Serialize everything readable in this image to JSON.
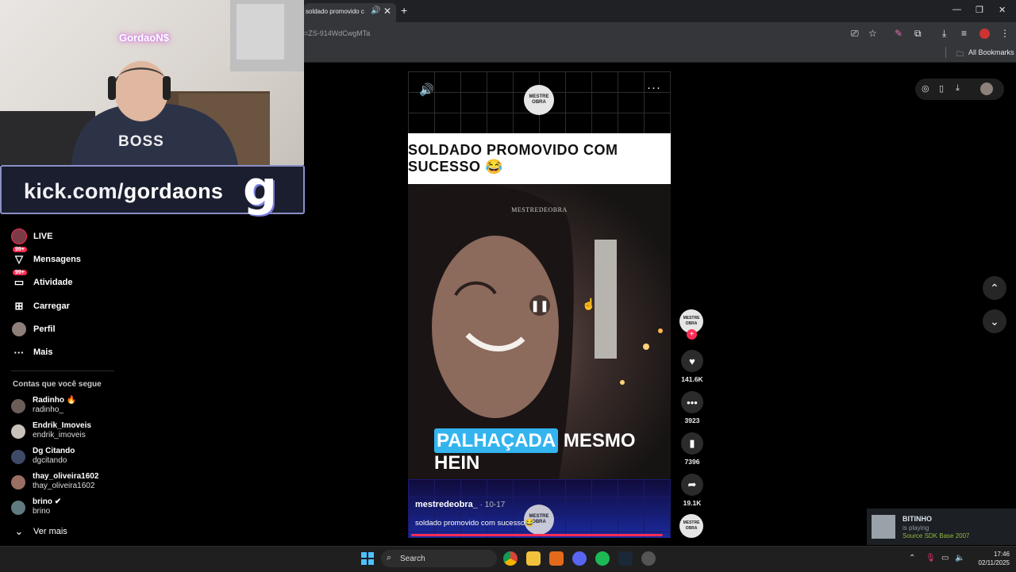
{
  "browser": {
    "tab_title": "soldado promovido c",
    "url": "=ZS-914WdCwgMTa",
    "all_bookmarks": "All Bookmarks"
  },
  "stream": {
    "cam_neon_text": "GordaoN$",
    "shirt_text": "BOSS",
    "kick_url_prefix": "kick.com/",
    "kick_url_name": "gordaons",
    "kick_logo": "g"
  },
  "sidebar": {
    "items": [
      {
        "label": "LIVE",
        "icon": "live-avatar-icon"
      },
      {
        "label": "Mensagens",
        "icon": "message-icon",
        "badge": "99+"
      },
      {
        "label": "Atividade",
        "icon": "activity-icon",
        "badge": "99+"
      },
      {
        "label": "Carregar",
        "icon": "upload-icon"
      },
      {
        "label": "Perfil",
        "icon": "profile-avatar-icon"
      },
      {
        "label": "Mais",
        "icon": "more-icon"
      }
    ],
    "following_title": "Contas que você segue",
    "accounts": [
      {
        "name": "Radinho 🔥",
        "handle": "radinho_"
      },
      {
        "name": "Endrik_Imoveis",
        "handle": "endrik_imoveis"
      },
      {
        "name": "Dg Citando",
        "handle": "dgcitando"
      },
      {
        "name": "thay_oliveira1602",
        "handle": "thay_oliveira1602"
      },
      {
        "name": "brino ✔",
        "handle": "brino"
      }
    ],
    "see_more": "Ver mais"
  },
  "video": {
    "title": "SOLDADO PROMOVIDO COM SUCESSO 😂",
    "watermark": "MESTREDEOBRA",
    "caption_highlight": "PALHAÇADA",
    "caption_rest": " MESMO HEIN",
    "author": "mestredeobra_",
    "date": " · 10-17",
    "description": "soldado promovido com sucesso😂",
    "logo_text": "MESTRE OBRA",
    "progress_fraction": 0.98
  },
  "actions": {
    "likes": "141.6K",
    "comments": "3923",
    "saves": "7396",
    "shares": "19.1K"
  },
  "steam": {
    "name": "BITINHO",
    "status": "is playing",
    "game": "Source SDK Base 2007"
  },
  "taskbar": {
    "search": "Search",
    "time": "17:46",
    "date": "02/11/2025"
  }
}
